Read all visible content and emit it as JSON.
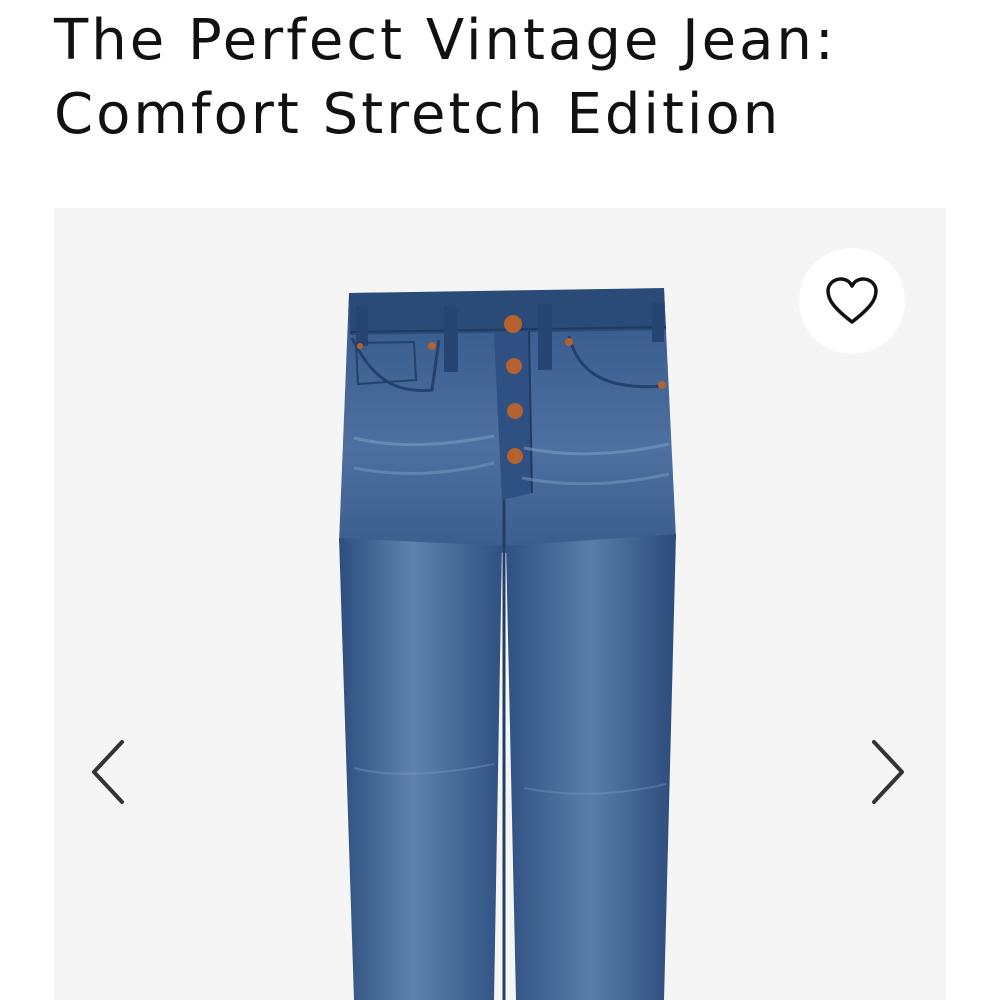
{
  "product": {
    "title_line1": "The Perfect Vintage Jean:",
    "title_line2": "Comfort Stretch Edition"
  },
  "gallery": {
    "background": "#f5f5f5",
    "image_subject": "high-rise button-fly denim jeans, medium blue wash",
    "favorite_icon": "heart-outline-icon",
    "prev_icon": "chevron-left-icon",
    "next_icon": "chevron-right-icon"
  },
  "colors": {
    "denim": "#33578a",
    "denim_light": "#5c7fa9",
    "denim_dark": "#233f66",
    "button_copper": "#b3612e",
    "text": "#111111",
    "arrow": "#333333"
  }
}
